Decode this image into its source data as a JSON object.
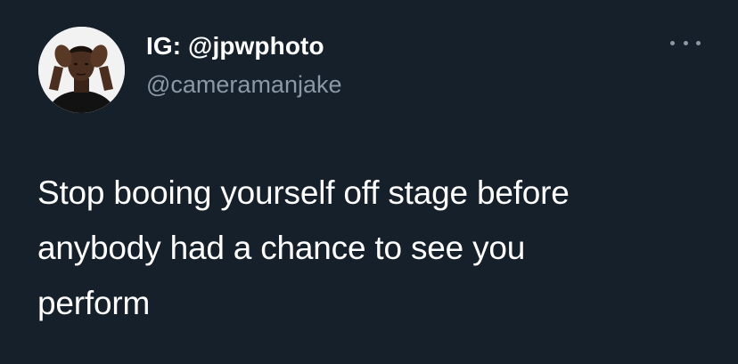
{
  "tweet": {
    "display_name": "IG: @jpwphoto",
    "handle": "@cameramanjake",
    "text_lines": [
      "Stop booing yourself off stage before",
      "anybody had a chance to see you",
      "perform"
    ]
  },
  "icons": {
    "more": "more-horizontal-icon"
  },
  "colors": {
    "background": "#16202b",
    "primary_text": "#ffffff",
    "secondary_text": "#8b98a5"
  }
}
